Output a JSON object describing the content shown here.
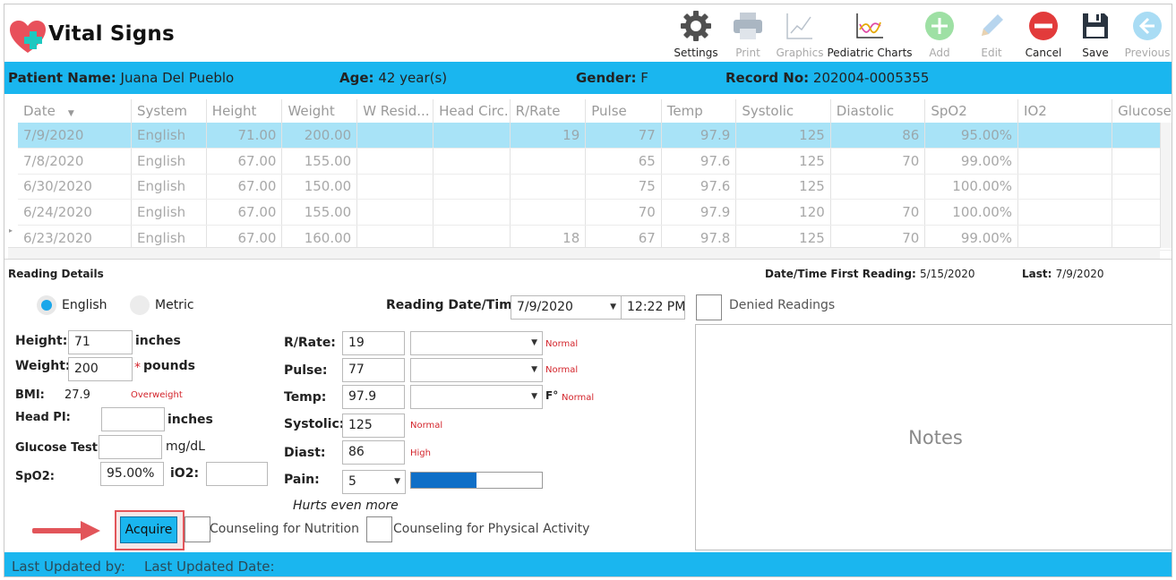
{
  "app": {
    "title": "Vital Signs"
  },
  "toolbar": [
    {
      "label": "Settings",
      "icon": "gear-icon",
      "enabled": true
    },
    {
      "label": "Print",
      "icon": "printer-icon",
      "enabled": false
    },
    {
      "label": "Graphics",
      "icon": "line-chart-icon",
      "enabled": false
    },
    {
      "label": "Pediatric Charts",
      "icon": "pediatric-chart-icon",
      "enabled": true
    },
    {
      "label": "Add",
      "icon": "plus-circle-icon",
      "enabled": false
    },
    {
      "label": "Edit",
      "icon": "pencil-icon",
      "enabled": false
    },
    {
      "label": "Cancel",
      "icon": "minus-circle-icon",
      "enabled": true
    },
    {
      "label": "Save",
      "icon": "floppy-disk-icon",
      "enabled": true
    },
    {
      "label": "Previous",
      "icon": "arrow-left-circle-icon",
      "enabled": false
    }
  ],
  "patient": {
    "name_label": "Patient Name:",
    "name": "Juana Del Pueblo",
    "age_label": "Age:",
    "age": "42 year(s)",
    "gender_label": "Gender:",
    "gender": "F",
    "record_label": "Record No:",
    "record": "202004-0005355"
  },
  "grid": {
    "columns": [
      "Date",
      "System",
      "Height",
      "Weight",
      "W Resid...",
      "Head Circ.",
      "R/Rate",
      "Pulse",
      "Temp",
      "Systolic",
      "Diastolic",
      "SpO2",
      "IO2",
      "Glucose"
    ],
    "rows": [
      [
        "7/9/2020",
        "English",
        "71.00",
        "200.00",
        "",
        "",
        "19",
        "77",
        "97.9",
        "125",
        "86",
        "95.00%",
        "",
        ""
      ],
      [
        "7/8/2020",
        "English",
        "67.00",
        "155.00",
        "",
        "",
        "",
        "65",
        "97.6",
        "125",
        "70",
        "99.00%",
        "",
        ""
      ],
      [
        "6/30/2020",
        "English",
        "67.00",
        "150.00",
        "",
        "",
        "",
        "75",
        "97.6",
        "125",
        "",
        "100.00%",
        "",
        ""
      ],
      [
        "6/24/2020",
        "English",
        "67.00",
        "155.00",
        "",
        "",
        "",
        "70",
        "97.9",
        "120",
        "70",
        "100.00%",
        "",
        ""
      ],
      [
        "6/23/2020",
        "English",
        "67.00",
        "160.00",
        "",
        "",
        "18",
        "67",
        "97.8",
        "125",
        "70",
        "99.00%",
        "",
        ""
      ]
    ],
    "selected_row": 0
  },
  "details": {
    "section_title": "Reading Details",
    "first_reading_label": "Date/Time First Reading:",
    "first_reading": "5/15/2020",
    "last_label": "Last:",
    "last": "7/9/2020",
    "system_english": "English",
    "system_metric": "Metric",
    "reading_datetime_label": "Reading Date/Time:",
    "reading_date": "7/9/2020",
    "reading_time": "12:22 PM",
    "denied_readings": "Denied Readings",
    "height_label": "Height:",
    "height": "71",
    "height_unit": "inches",
    "weight_label": "Weight:",
    "weight": "200",
    "weight_required": "*",
    "weight_unit": "pounds",
    "bmi_label": "BMI:",
    "bmi": "27.9",
    "bmi_status": "Overweight",
    "head_pi_label": "Head PI:",
    "head_pi": "",
    "head_pi_unit": "inches",
    "glucose_label": "Glucose Test:",
    "glucose": "",
    "glucose_unit": "mg/dL",
    "spo2_label": "SpO2:",
    "spo2": "95.00%",
    "io2_label": "iO2:",
    "io2": "",
    "rrate_label": "R/Rate:",
    "rrate": "19",
    "rrate_status": "Normal",
    "pulse_label": "Pulse:",
    "pulse": "77",
    "pulse_status": "Normal",
    "temp_label": "Temp:",
    "temp": "97.9",
    "temp_unit": "F°",
    "temp_status": "Normal",
    "systolic_label": "Systolic:",
    "systolic": "125",
    "systolic_status": "Normal",
    "diast_label": "Diast:",
    "diast": "86",
    "diast_status": "High",
    "pain_label": "Pain:",
    "pain": "5",
    "pain_fraction": 0.5,
    "pain_text": "Hurts even more",
    "notes_placeholder": "Notes",
    "acquire": "Acquire",
    "counseling_nutrition": "Counseling for Nutrition",
    "counseling_physical": "Counseling for Physical Activity"
  },
  "footer": {
    "updated_by": "Last Updated by:",
    "updated_date": "Last Updated Date:"
  },
  "colors": {
    "accent": "#1ab6ef",
    "selected_row": "#a8e3f7",
    "status_red": "#d3242b",
    "highlight": "#e2555a"
  }
}
